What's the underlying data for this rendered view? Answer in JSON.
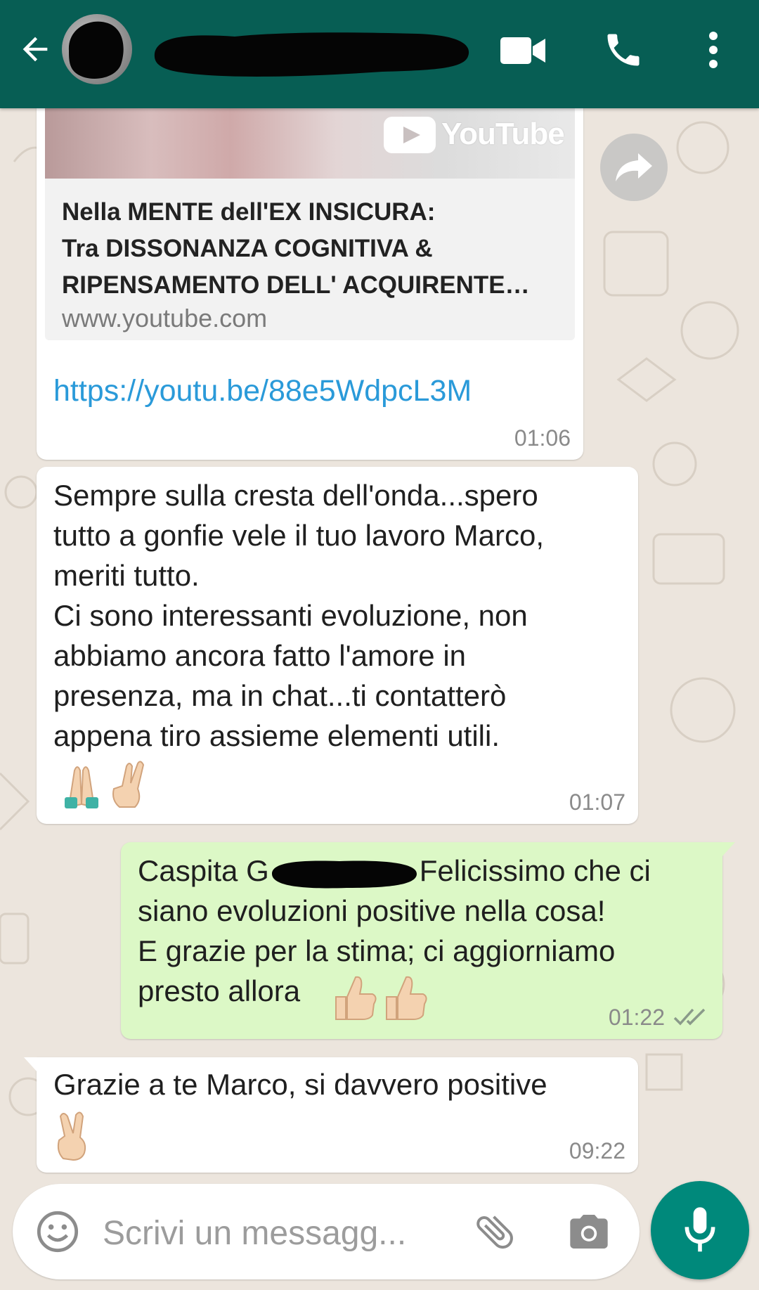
{
  "header": {
    "contact_name": "",
    "colors": {
      "bar": "#075e54",
      "icons": "#ffffff"
    },
    "icons": [
      "arrow-back-icon",
      "avatar",
      "video-call-icon",
      "phone-icon",
      "more-vert-icon"
    ]
  },
  "messages": [
    {
      "direction": "incoming",
      "type": "link-preview",
      "preview": {
        "source_logo": "YouTube",
        "title": "Nella MENTE dell'EX INSICURA: Tra DISSONANZA COGNITIVA & RIPENSAMENTO DELL' ACQUIRENTE…",
        "title_lines": [
          "Nella MENTE dell'EX INSICURA:",
          "Tra DISSONANZA COGNITIVA &",
          "RIPENSAMENTO DELL' ACQUIRENTE…"
        ],
        "domain": "www.youtube.com"
      },
      "link": "https://youtu.be/88e5WdpcL3M",
      "time": "01:06"
    },
    {
      "direction": "incoming",
      "text": "Sempre sulla cresta dell'onda...spero\ntutto a gonfie vele il tuo lavoro Marco,\nmeriti tutto.\nCi sono interessanti evoluzione, non\nabbiamo ancora fatto l'amore in\npresenza, ma in chat...ti contatterò\nappena tiro assieme elementi utili.",
      "emojis": [
        "🙏",
        "🤞"
      ],
      "time": "01:07"
    },
    {
      "direction": "outgoing",
      "text_start": "Caspita G",
      "text_rest": "Felicissimo che ci\nsiano evoluzioni positive nella cosa!\nE grazie per la stima; ci aggiorniamo\npresto allora",
      "emojis": [
        "👍",
        "👍"
      ],
      "time": "01:22",
      "status": "read-double-check"
    },
    {
      "direction": "incoming",
      "text": "Grazie a te Marco, si davvero positive",
      "emojis": [
        "✌️"
      ],
      "time": "09:22"
    }
  ],
  "composer": {
    "placeholder": "Scrivi un messagg...",
    "icons": [
      "emoji-icon",
      "attach-icon",
      "camera-icon",
      "mic-icon"
    ],
    "accent": "#00897b"
  },
  "colors": {
    "chat_background": "#ece5dd",
    "incoming_bubble": "#ffffff",
    "outgoing_bubble": "#dcf8c6",
    "link": "#2a9ad9",
    "read_tick": "#8a8a8a"
  }
}
